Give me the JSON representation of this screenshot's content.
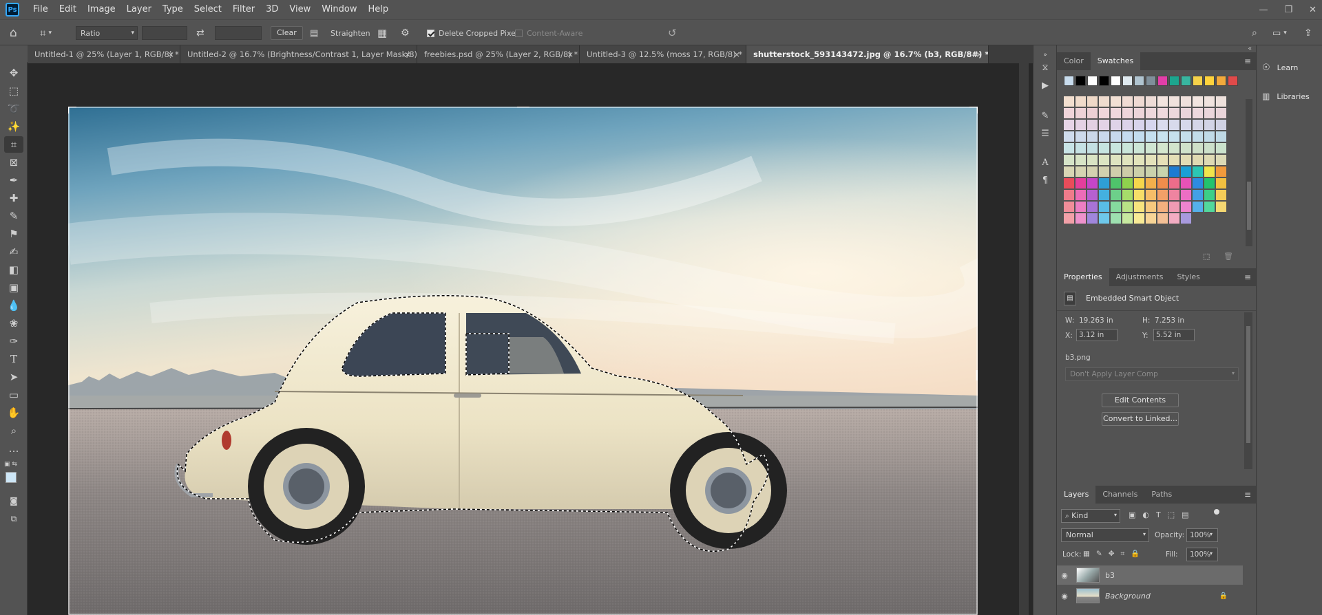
{
  "app": {
    "logo": "Ps"
  },
  "menu": [
    "File",
    "Edit",
    "Image",
    "Layer",
    "Type",
    "Select",
    "Filter",
    "3D",
    "View",
    "Window",
    "Help"
  ],
  "options": {
    "ratio": "Ratio",
    "clear": "Clear",
    "straighten": "Straighten",
    "delete_cropped": "Delete Cropped Pixels",
    "content_aware": "Content-Aware"
  },
  "tabs": [
    {
      "label": "Untitled-1 @ 25% (Layer 1, RGB/8) *"
    },
    {
      "label": "Untitled-2 @ 16.7% (Brightness/Contrast 1, Layer Mask/8) *"
    },
    {
      "label": "freebies.psd @ 25% (Layer 2, RGB/8) *"
    },
    {
      "label": "Untitled-3 @ 12.5% (moss 17, RGB/8) *"
    },
    {
      "label": "shutterstock_593143472.jpg @ 16.7% (b3, RGB/8#) *"
    }
  ],
  "tab_close": "×",
  "swatches_panel": {
    "tabs": [
      "Color",
      "Swatches"
    ],
    "active": "Swatches"
  },
  "properties_panel": {
    "tabs": [
      "Properties",
      "Adjustments",
      "Styles"
    ],
    "type_label": "Embedded Smart Object",
    "w_label": "W:",
    "w_value": "19.263 in",
    "h_label": "H:",
    "h_value": "7.253 in",
    "x_label": "X:",
    "x_value": "3.12 in",
    "y_label": "Y:",
    "y_value": "5.52 in",
    "filename": "b3.png",
    "layer_comp": "Don't Apply Layer Comp",
    "edit_contents": "Edit Contents",
    "convert_linked": "Convert to Linked..."
  },
  "layers_panel": {
    "tabs": [
      "Layers",
      "Channels",
      "Paths"
    ],
    "kind": "Kind",
    "blend_mode": "Normal",
    "opacity_label": "Opacity:",
    "opacity_value": "100%",
    "lock_label": "Lock:",
    "fill_label": "Fill:",
    "fill_value": "100%",
    "layers": [
      {
        "name": "b3",
        "selected": true
      },
      {
        "name": "Background",
        "selected": false
      }
    ]
  },
  "side_panel": {
    "learn": "Learn",
    "libraries": "Libraries"
  }
}
